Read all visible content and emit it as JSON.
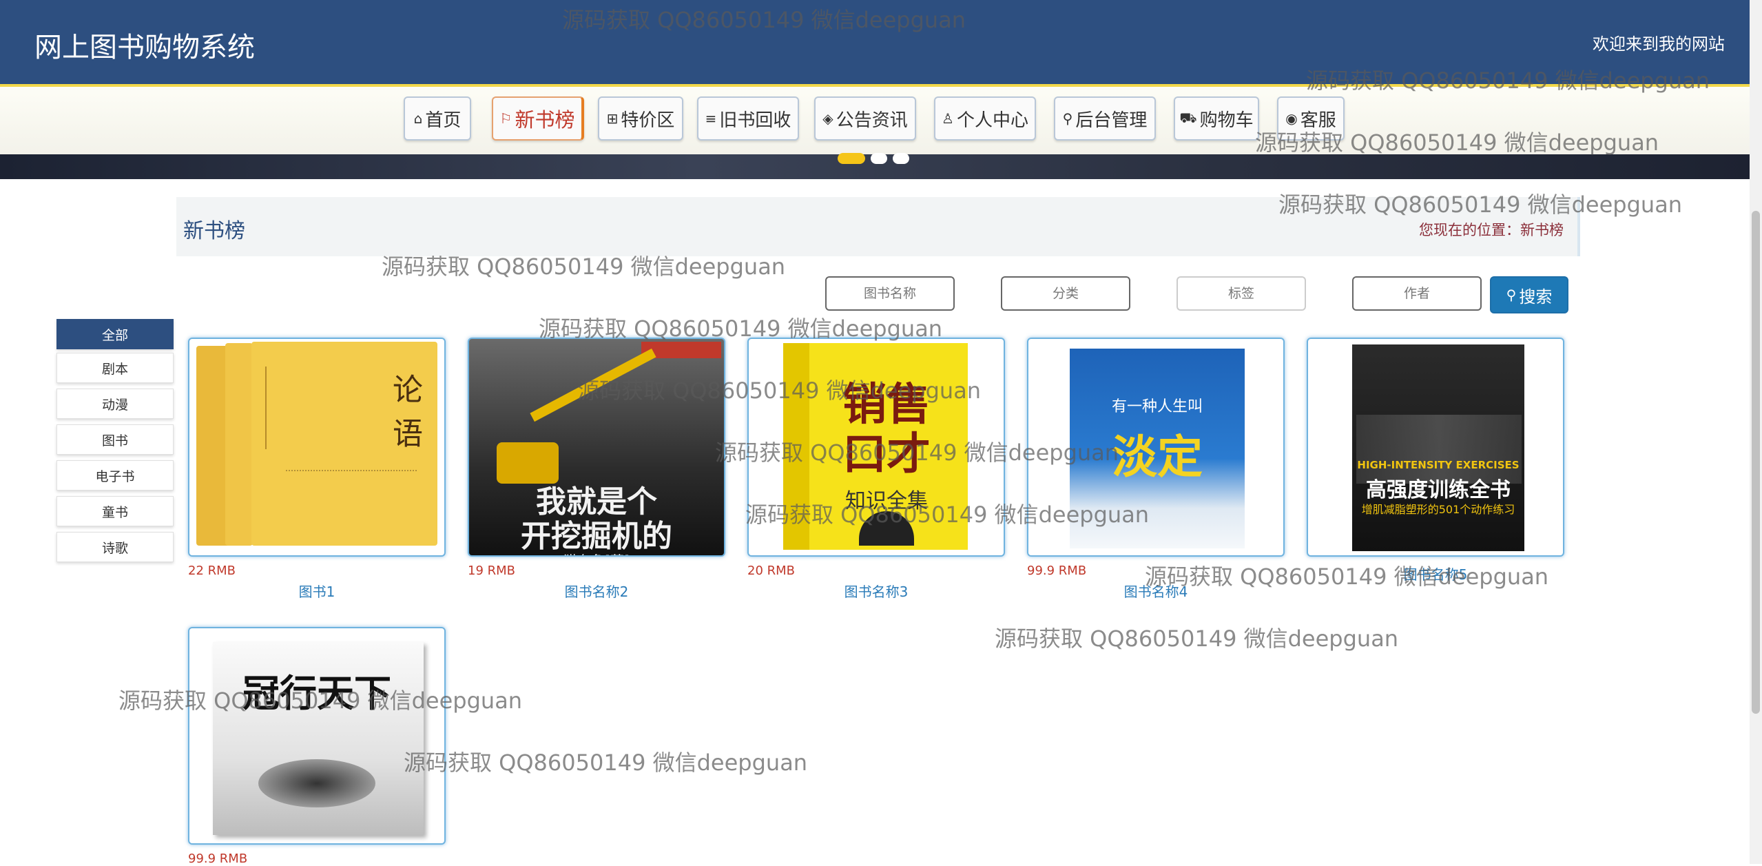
{
  "header": {
    "title": "网上图书购物系统",
    "welcome": "欢迎来到我的网站"
  },
  "nav": [
    {
      "label": "首页",
      "icon": "home-icon",
      "glyph": "⌂"
    },
    {
      "label": "新书榜",
      "icon": "flag-icon",
      "glyph": "⚐"
    },
    {
      "label": "特价区",
      "icon": "grid-icon",
      "glyph": "⊞"
    },
    {
      "label": "旧书回收",
      "icon": "sliders-icon",
      "glyph": "≡"
    },
    {
      "label": "公告资讯",
      "icon": "layers-icon",
      "glyph": "◈"
    },
    {
      "label": "个人中心",
      "icon": "user-icon",
      "glyph": "♙"
    },
    {
      "label": "后台管理",
      "icon": "link-icon",
      "glyph": "⚲"
    },
    {
      "label": "购物车",
      "icon": "cart-icon",
      "glyph": "⛟"
    },
    {
      "label": "客服",
      "icon": "chat-icon",
      "glyph": "◉"
    }
  ],
  "section": {
    "title": "新书榜",
    "breadcrumb": "您现在的位置：新书榜"
  },
  "search": {
    "name_placeholder": "图书名称",
    "category_placeholder": "分类",
    "tag_placeholder": "标签",
    "author_placeholder": "作者",
    "button_label": "搜索"
  },
  "categories": [
    "全部",
    "剧本",
    "动漫",
    "图书",
    "电子书",
    "童书",
    "诗歌"
  ],
  "books": [
    {
      "price": "22 RMB",
      "name": "图书1",
      "cover_text": [
        "论",
        "语"
      ]
    },
    {
      "price": "19 RMB",
      "name": "图书名称2",
      "cover_text": [
        "我就是个",
        "开挖掘机的",
        "猫有鱼[著]"
      ]
    },
    {
      "price": "20 RMB",
      "name": "图书名称3",
      "cover_text": [
        "销售",
        "口才",
        "知识全集"
      ]
    },
    {
      "price": "99.9 RMB",
      "name": "图书名称4",
      "cover_text": [
        "有一种人生叫",
        "淡定"
      ]
    },
    {
      "price": "",
      "name": "图书名称5",
      "cover_text": [
        "HIGH-INTENSITY EXERCISES",
        "高强度训练全书",
        "增肌减脂塑形的501个动作练习"
      ]
    },
    {
      "price": "99.9 RMB",
      "name": "",
      "cover_text": [
        "冠行天下"
      ]
    }
  ],
  "watermark": "源码获取 QQ86050149 微信deepguan"
}
